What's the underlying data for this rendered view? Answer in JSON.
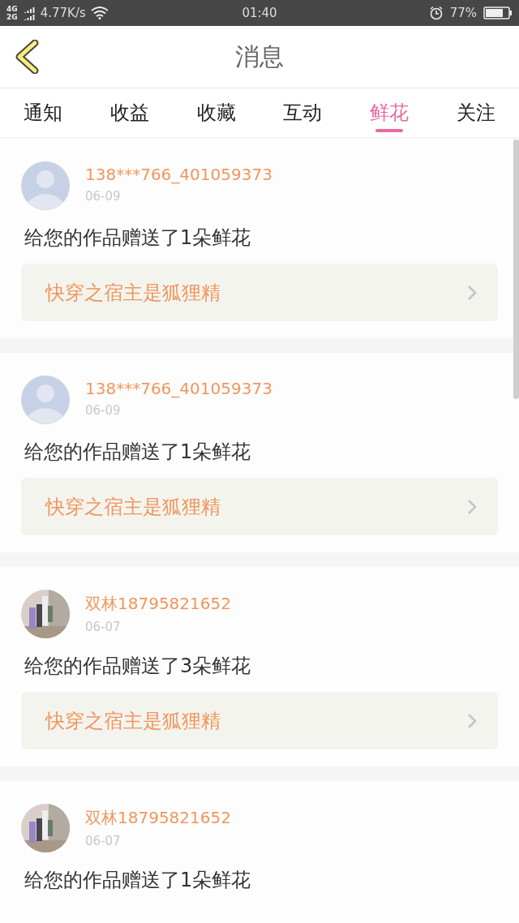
{
  "status_bar": {
    "networks": [
      "4G",
      "2G"
    ],
    "speed": "4.77K/s",
    "time": "01:40",
    "battery": "77%"
  },
  "header": {
    "title": "消息"
  },
  "tabs": [
    {
      "label": "通知",
      "selected": false
    },
    {
      "label": "收益",
      "selected": false
    },
    {
      "label": "收藏",
      "selected": false
    },
    {
      "label": "互动",
      "selected": false
    },
    {
      "label": "鲜花",
      "selected": true
    },
    {
      "label": "关注",
      "selected": false
    }
  ],
  "messages": [
    {
      "avatar": {
        "kind": "default"
      },
      "name": "138***766_401059373",
      "date": "06-09",
      "text": "给您的作品赠送了1朵鲜花",
      "book": "快穿之宿主是狐狸精"
    },
    {
      "avatar": {
        "kind": "default"
      },
      "name": "138***766_401059373",
      "date": "06-09",
      "text": "给您的作品赠送了1朵鲜花",
      "book": "快穿之宿主是狐狸精"
    },
    {
      "name": "双林18795821652",
      "date": "06-07",
      "text": "给您的作品赠送了3朵鲜花",
      "book": "快穿之宿主是狐狸精"
    },
    {
      "name": "双林18795821652",
      "date": "06-07",
      "text": "给您的作品赠送了1朵鲜花"
    }
  ]
}
